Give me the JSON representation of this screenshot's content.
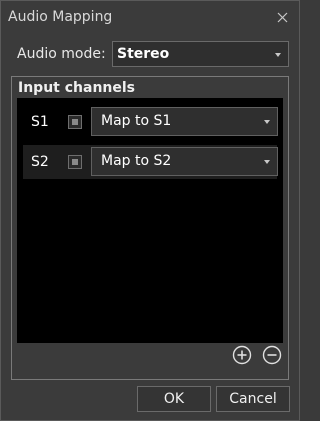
{
  "window": {
    "title": "Audio Mapping"
  },
  "audio_mode": {
    "label": "Audio mode:",
    "value": "Stereo"
  },
  "input_channels": {
    "title": "Input channels",
    "rows": [
      {
        "name": "S1",
        "mapping": "Map to S1"
      },
      {
        "name": "S2",
        "mapping": "Map to S2"
      }
    ]
  },
  "buttons": {
    "ok": "OK",
    "cancel": "Cancel"
  },
  "icons": {
    "close": "close-icon",
    "add": "plus-circle-icon",
    "remove": "minus-circle-icon",
    "dropdown": "chevron-down-icon"
  },
  "colors": {
    "background": "#3b3b3b",
    "list_background": "#000000",
    "selected_row": "#1e1e1e",
    "text": "#ffffff"
  }
}
